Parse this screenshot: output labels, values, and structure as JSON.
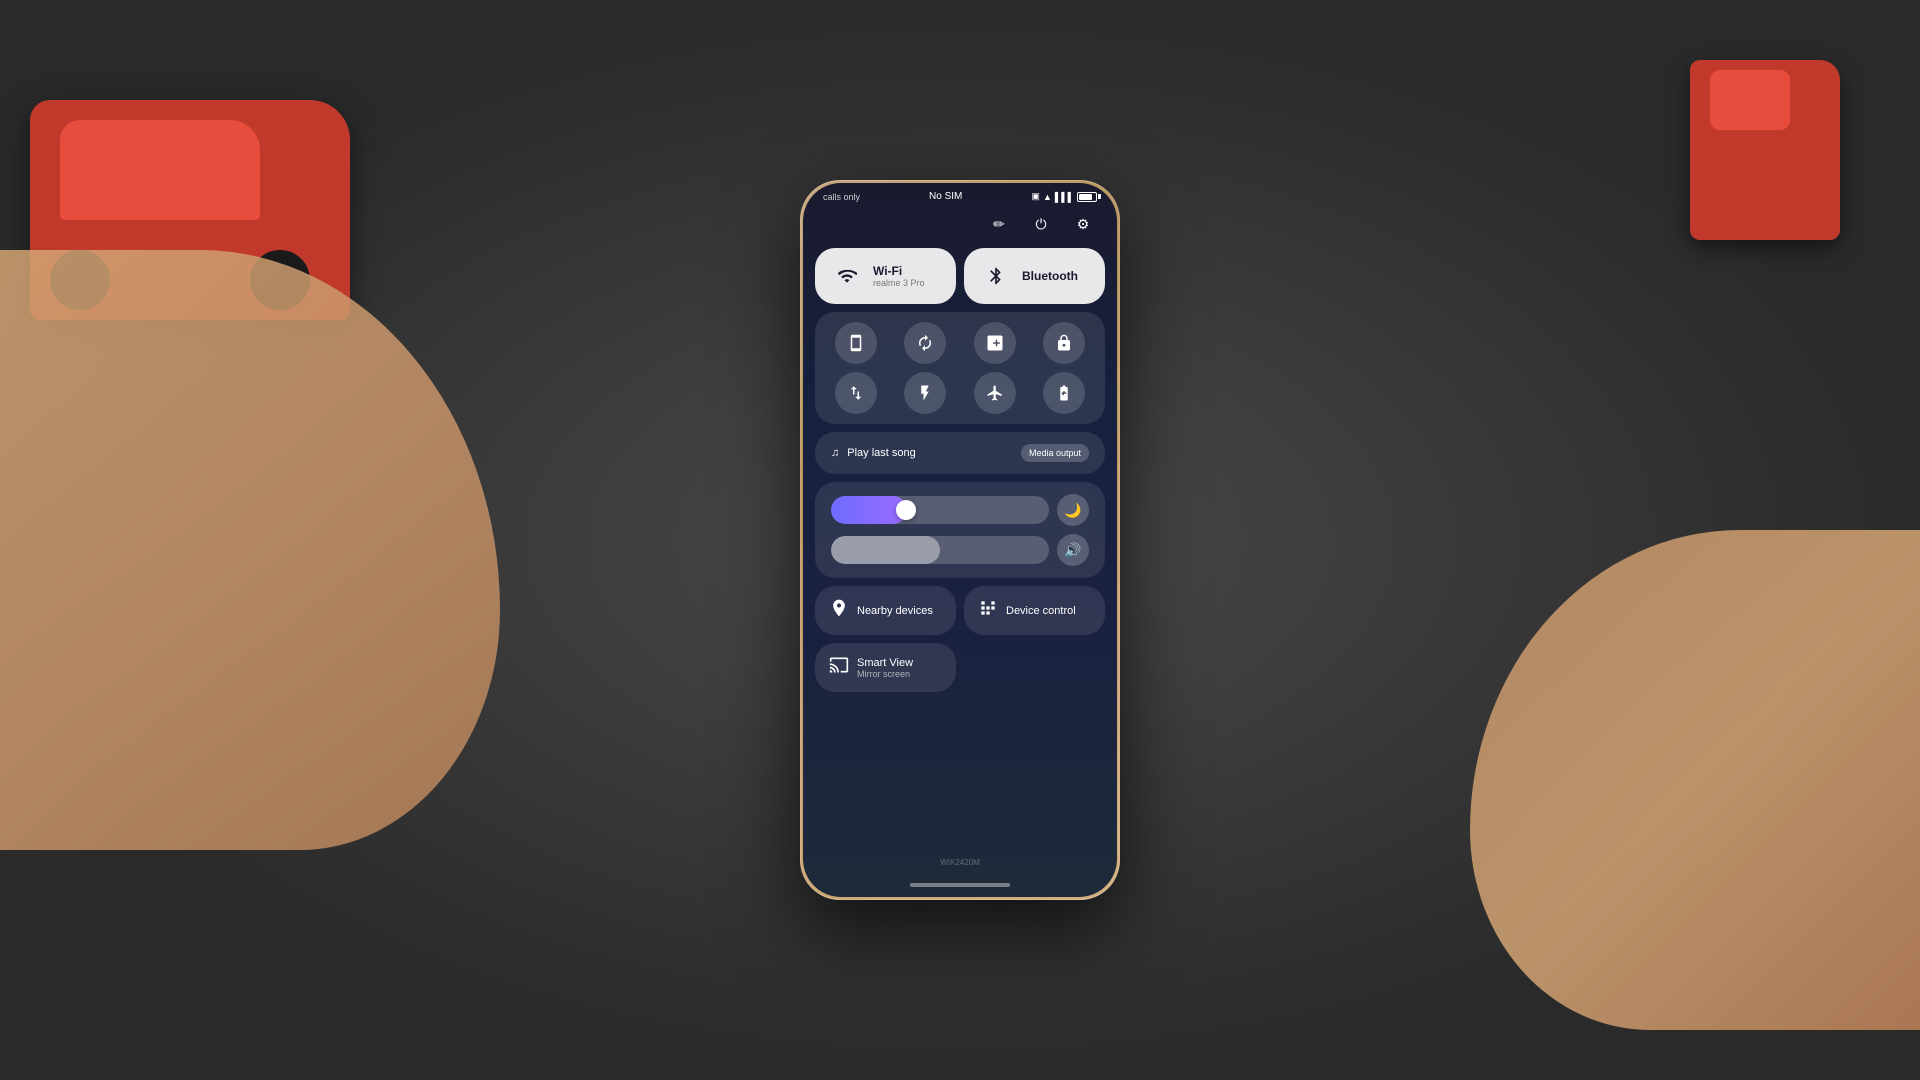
{
  "background": {
    "color": "#2e2e2e"
  },
  "phone": {
    "status_bar": {
      "left": "calls only",
      "center": "No SIM",
      "right_icons": [
        "screenshot",
        "wifi",
        "signal",
        "battery"
      ],
      "battery_level": "80"
    },
    "top_icons": [
      "pencil-icon",
      "power-icon",
      "settings-icon"
    ],
    "tiles": {
      "wifi": {
        "title": "Wi-Fi",
        "subtitle": "realme 3 Pro",
        "active": true
      },
      "bluetooth": {
        "title": "Bluetooth",
        "subtitle": "",
        "active": true
      }
    },
    "small_icons": [
      {
        "name": "screenshot-icon",
        "symbol": "⊡"
      },
      {
        "name": "rotate-icon",
        "symbol": "↻"
      },
      {
        "name": "nfc-icon",
        "symbol": "N"
      },
      {
        "name": "lock-icon",
        "symbol": "🔒"
      },
      {
        "name": "data-icon",
        "symbol": "⇅"
      },
      {
        "name": "flashlight-icon",
        "symbol": "🔦"
      },
      {
        "name": "airplane-icon",
        "symbol": "✈"
      },
      {
        "name": "battery-saver-icon",
        "symbol": "🔋"
      }
    ],
    "media_player": {
      "label": "Play last song",
      "media_output_label": "Media output"
    },
    "brightness_slider": {
      "value": 35
    },
    "volume_slider": {
      "value": 50
    },
    "bottom_tiles": {
      "nearby_devices": "Nearby devices",
      "device_control": "Device control"
    },
    "smart_view": {
      "title": "Smart View",
      "subtitle": "Mirror screen"
    },
    "model_number": "WIK2420M"
  }
}
